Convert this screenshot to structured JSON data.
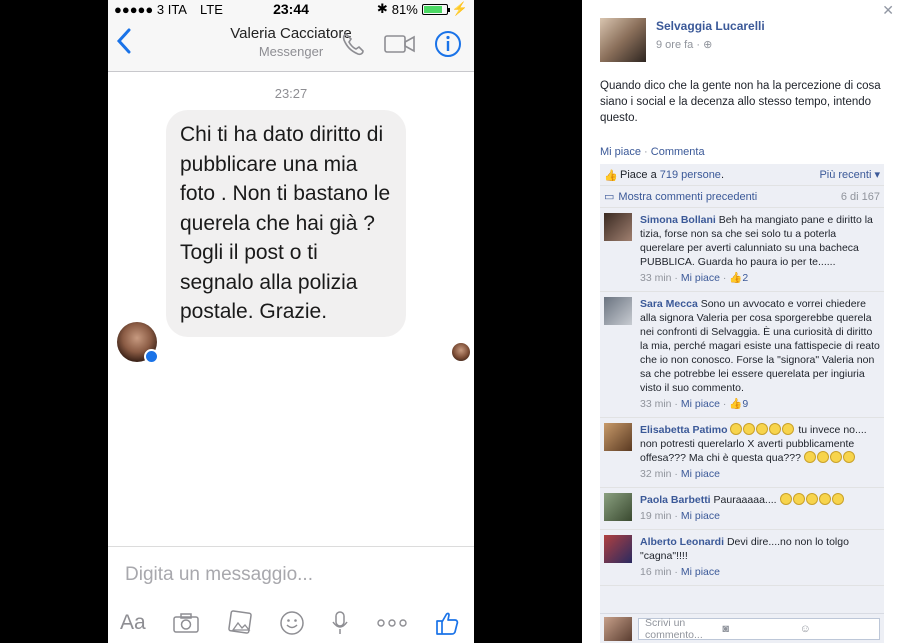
{
  "status_bar": {
    "carrier": "●●●●● 3 ITA",
    "network": "LTE",
    "time": "23:44",
    "battery": "81%",
    "battery_level": 0.81
  },
  "messenger": {
    "contact_name": "Valeria Cacciatore",
    "subtitle": "Messenger",
    "timestamp": "23:27",
    "message": "Chi ti ha dato diritto di pubblicare una mia foto . Non ti bastano le querela che hai già ? Togli il post o ti segnalo alla polizia postale. Grazie.",
    "input_placeholder": "Digita un messaggio...",
    "tools": [
      "Aa",
      "camera-icon",
      "gallery-icon",
      "emoji-icon",
      "microphone-icon",
      "more-icon",
      "like-icon"
    ],
    "accent_color": "#1a73e8"
  },
  "facebook": {
    "author": "Selvaggia Lucarelli",
    "meta": "9 ore fa ·",
    "post_text": "Quando dico che la gente non ha la percezione di cosa siano i social e la decenza allo stesso tempo, intendo questo.",
    "like_action": "Mi piace",
    "comment_action": "Commenta",
    "likes_prefix": "Piace a",
    "likes_count": "719 persone",
    "sort_label": "Più recenti",
    "previous_comments": "Mostra commenti precedenti",
    "comments_range": "6 di 167",
    "comments": [
      {
        "name": "Simona Bollani",
        "text": "Beh ha mangiato pane e diritto la tizia, forse non sa che sei solo tu a poterla querelare per averti calunniato su una bacheca PUBBLICA. Guarda ho paura io per te......",
        "time": "33 min",
        "like": "Mi piace",
        "likes": "2"
      },
      {
        "name": "Sara Mecca",
        "text": "Sono un avvocato e vorrei chiedere alla signora Valeria per cosa sporgerebbe querela nei confronti di Selvaggia. È una curiosità di diritto la mia, perché magari esiste una fattispecie di reato che io non conosco. Forse la \"signora\" Valeria non sa che potrebbe lei essere querelata per ingiuria visto il suo commento.",
        "time": "33 min",
        "like": "Mi piace",
        "likes": "9"
      },
      {
        "name": "Elisabetta Patimo",
        "text_before": "",
        "text_after": "tu invece no.... non potresti querelarlo X averti pubblicamente offesa??? Ma chi è questa qua???",
        "time": "32 min",
        "like": "Mi piace"
      },
      {
        "name": "Paola Barbetti",
        "text": "Pauraaaaa....",
        "time": "19 min",
        "like": "Mi piace"
      },
      {
        "name": "Alberto Leonardi",
        "text": "Devi dire....no non lo tolgo \"cagna\"!!!!",
        "time": "16 min",
        "like": "Mi piace"
      }
    ],
    "comment_placeholder": "Scrivi un commento...",
    "link_color": "#3b5998"
  }
}
